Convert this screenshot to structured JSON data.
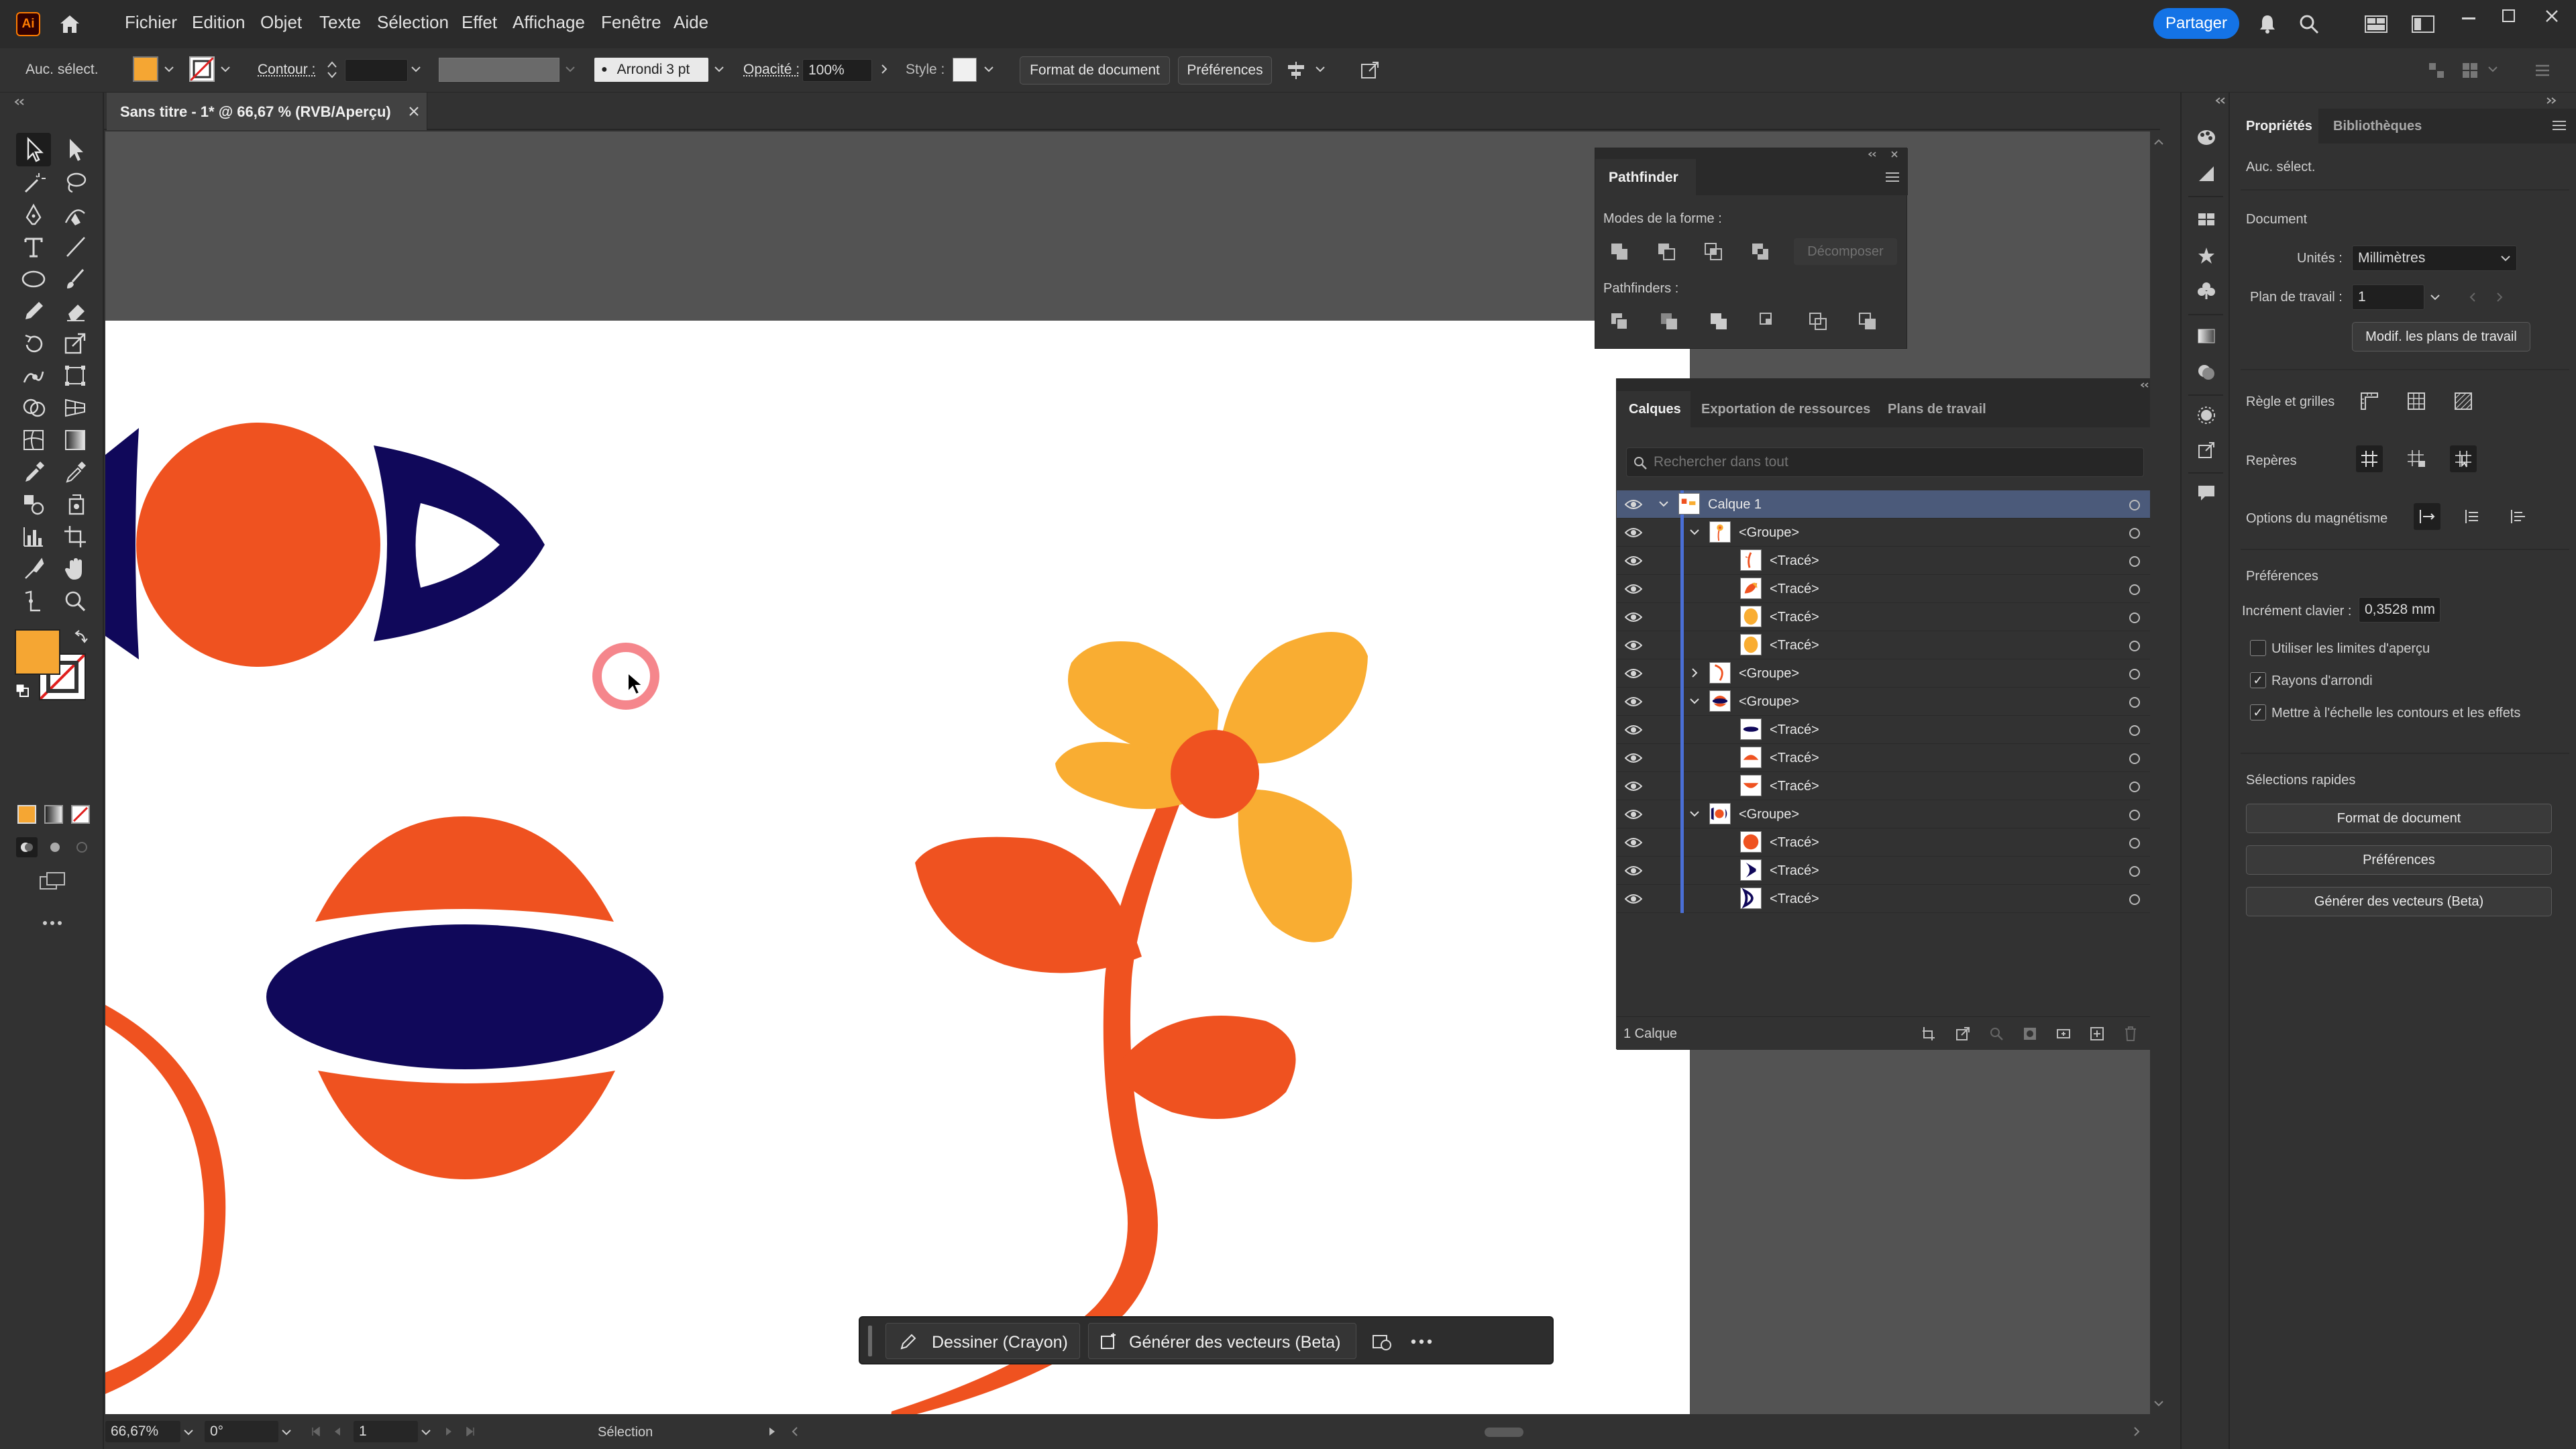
{
  "app": {
    "logo": "Ai"
  },
  "menu": {
    "items": [
      "Fichier",
      "Edition",
      "Objet",
      "Texte",
      "Sélection",
      "Effet",
      "Affichage",
      "Fenêtre",
      "Aide"
    ],
    "share": "Partager"
  },
  "control": {
    "selection": "Auc. sélect.",
    "fill_color": "#f5a633",
    "stroke_label": "Contour :",
    "brush": "Arrondi 3 pt",
    "opacity_label": "Opacité :",
    "opacity_value": "100%",
    "style_label": "Style :",
    "doc_format": "Format de document",
    "preferences": "Préférences"
  },
  "document_tab": {
    "title": "Sans titre - 1* @ 66,67 % (RVB/Aperçu)"
  },
  "pathfinder": {
    "title": "Pathfinder",
    "shape_modes": "Modes de la forme :",
    "expand": "Décomposer",
    "pathfinders": "Pathfinders :"
  },
  "layers_panel": {
    "tabs": [
      "Calques",
      "Exportation de ressources",
      "Plans de travail"
    ],
    "search_placeholder": "Rechercher dans tout",
    "rows": [
      {
        "name": "Calque 1",
        "level": 0,
        "twirl": "open",
        "thumb": "layer"
      },
      {
        "name": "<Groupe>",
        "level": 1,
        "twirl": "open",
        "thumb": "flower"
      },
      {
        "name": "<Tracé>",
        "level": 2,
        "twirl": "none",
        "thumb": "stem"
      },
      {
        "name": "<Tracé>",
        "level": 2,
        "twirl": "none",
        "thumb": "leaf"
      },
      {
        "name": "<Tracé>",
        "level": 2,
        "twirl": "none",
        "thumb": "petal"
      },
      {
        "name": "<Tracé>",
        "level": 2,
        "twirl": "none",
        "thumb": "petal"
      },
      {
        "name": "<Groupe>",
        "level": 1,
        "twirl": "closed",
        "thumb": "arc"
      },
      {
        "name": "<Groupe>",
        "level": 1,
        "twirl": "open",
        "thumb": "planet"
      },
      {
        "name": "<Tracé>",
        "level": 2,
        "twirl": "none",
        "thumb": "band"
      },
      {
        "name": "<Tracé>",
        "level": 2,
        "twirl": "none",
        "thumb": "top"
      },
      {
        "name": "<Tracé>",
        "level": 2,
        "twirl": "none",
        "thumb": "bottom"
      },
      {
        "name": "<Groupe>",
        "level": 1,
        "twirl": "open",
        "thumb": "eye"
      },
      {
        "name": "<Tracé>",
        "level": 2,
        "twirl": "none",
        "thumb": "dot"
      },
      {
        "name": "<Tracé>",
        "level": 2,
        "twirl": "none",
        "thumb": "leftc"
      },
      {
        "name": "<Tracé>",
        "level": 2,
        "twirl": "none",
        "thumb": "rightc"
      }
    ],
    "footer": "1 Calque"
  },
  "properties": {
    "tabs": [
      "Propriétés",
      "Bibliothèques"
    ],
    "selection": "Auc. sélect.",
    "document": "Document",
    "units_label": "Unités :",
    "units_value": "Millimètres",
    "artboard_label": "Plan de travail :",
    "artboard_value": "1",
    "edit_artboards": "Modif. les plans de travail",
    "rulers_grids": "Règle et grilles",
    "guides": "Repères",
    "snap_options": "Options du magnétisme",
    "preferences": "Préférences",
    "keyboard_increment_label": "Incrément clavier :",
    "keyboard_increment_value": "0,3528 mm",
    "checkbox_preview_bounds": "Utiliser les limites d'aperçu",
    "checkbox_corner_radius": "Rayons d'arrondi",
    "checkbox_scale_strokes": "Mettre à l'échelle les contours et les effets",
    "quick_actions": "Sélections rapides",
    "btn_doc_format": "Format de document",
    "btn_preferences": "Préférences",
    "btn_generate_vectors": "Générer des vecteurs (Beta)"
  },
  "context_bar": {
    "draw": "Dessiner (Crayon)",
    "generate": "Générer des vecteurs (Beta)"
  },
  "status": {
    "zoom": "66,67%",
    "rotation": "0°",
    "artboard": "1",
    "tool": "Sélection"
  },
  "colors": {
    "orange": "#ef5220",
    "yellow": "#f9ad32",
    "navy": "#10085a",
    "accent": "#2f74d0"
  }
}
